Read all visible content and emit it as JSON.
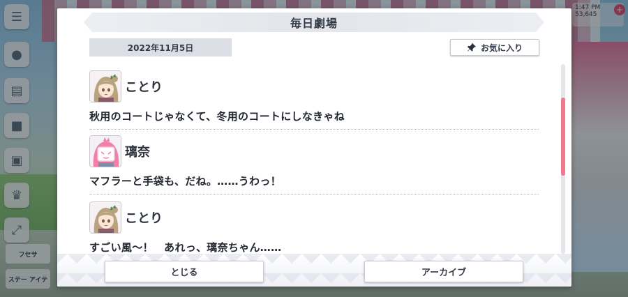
{
  "dialog": {
    "title": "毎日劇場",
    "date": "2022年11月5日",
    "favorite_label": "お気に入り",
    "close_label": "とじる",
    "archive_label": "アーカイブ"
  },
  "entries": [
    {
      "speaker": "ことり",
      "line": "秋用のコートじゃなくて、冬用のコートにしなきゃね",
      "avatar_icon": "kotori-avatar"
    },
    {
      "speaker": "璃奈",
      "line": "マフラーと手袋も、だね。……うわっ！",
      "avatar_icon": "rina-avatar"
    },
    {
      "speaker": "ことり",
      "line": "すごい風〜！　あれっ、璃奈ちゃん……",
      "avatar_icon": "kotori-avatar"
    }
  ],
  "background": {
    "side_labels": [
      "フセサ",
      "ステー\nアイテ"
    ],
    "top_right_text": "1:47 PM\n53,645"
  },
  "colors": {
    "accent_scroll": "#f0788f",
    "title_bar": "#e3e5ea",
    "date_box": "#dcdee6"
  }
}
